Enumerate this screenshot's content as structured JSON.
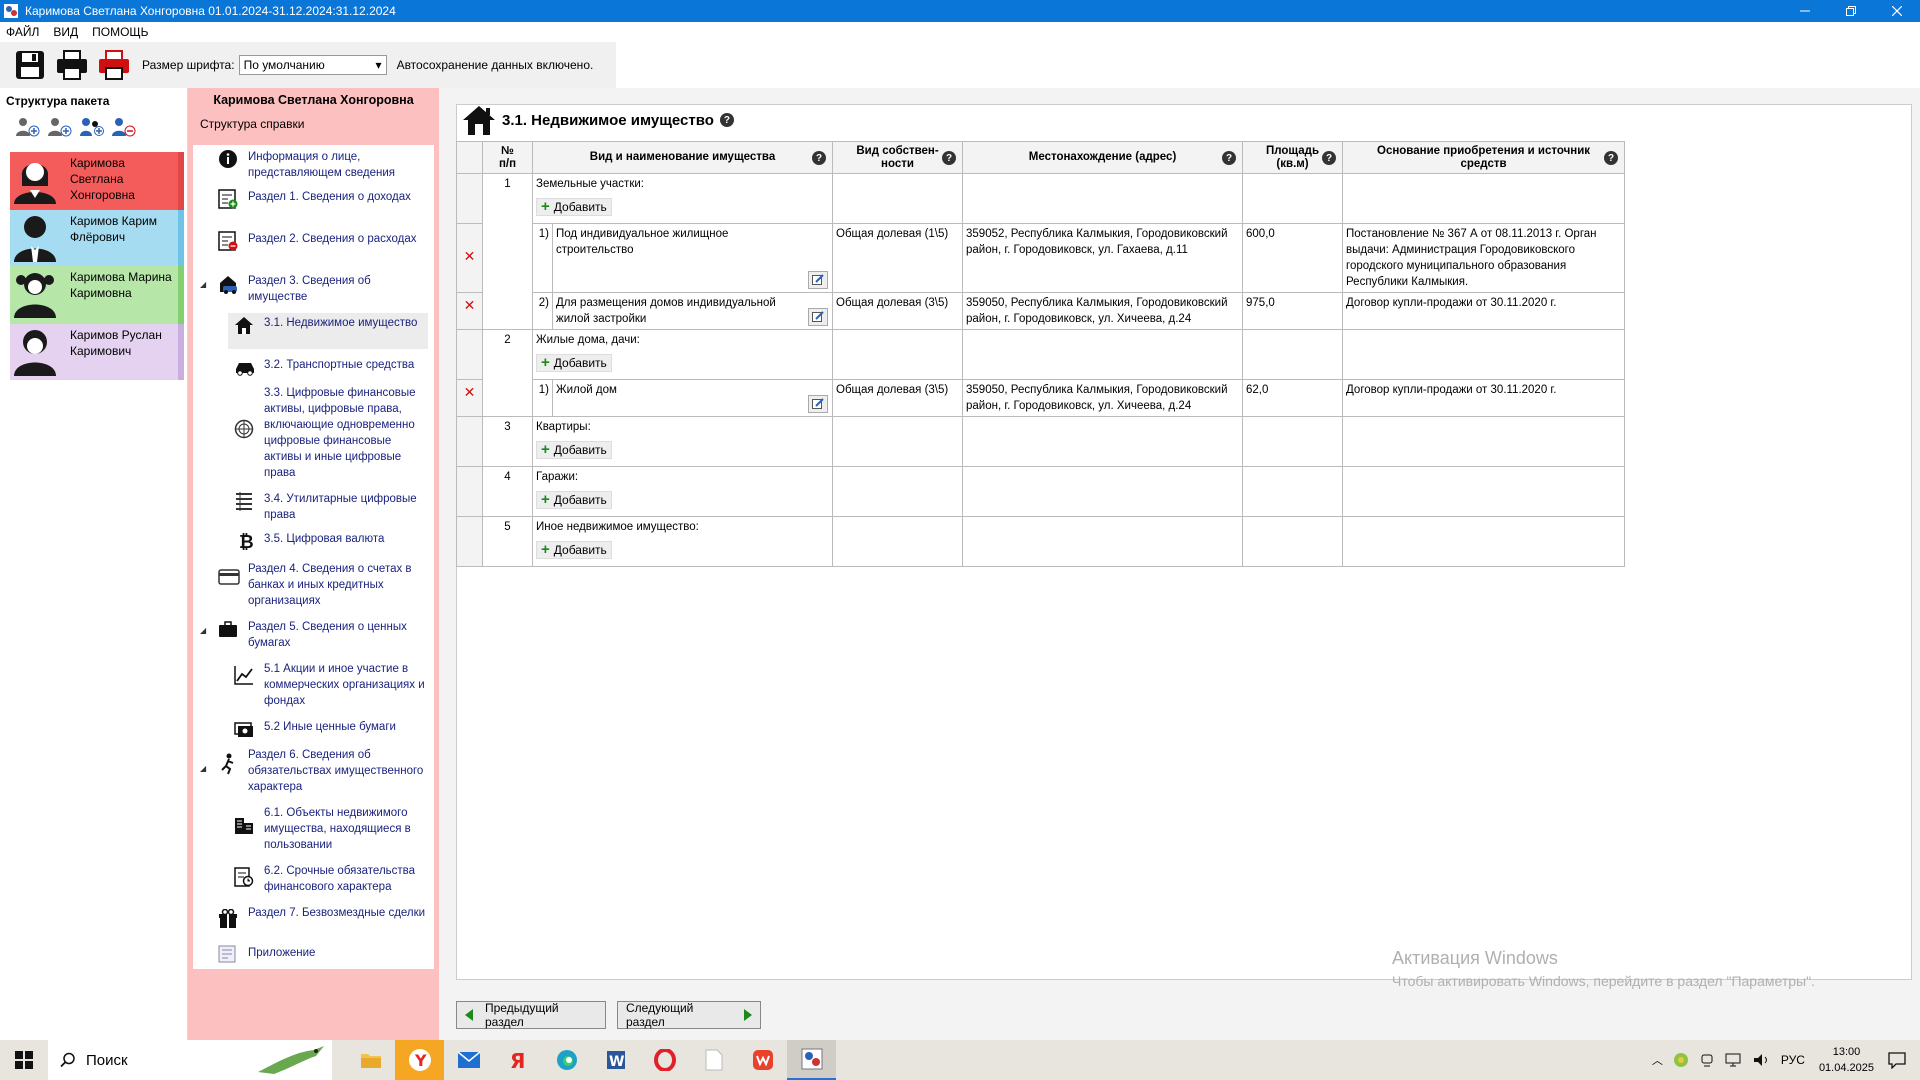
{
  "window": {
    "title": "Каримова Светлана Хонгоровна 01.01.2024-31.12.2024:31.12.2024"
  },
  "menu": [
    "ФАЙЛ",
    "ВИД",
    "ПОМОЩЬ"
  ],
  "toolbar": {
    "font_size_label": "Размер шрифта:",
    "font_size_value": "По умолчанию",
    "autosave": "Автосохранение данных включено."
  },
  "package": {
    "title": "Структура пакета",
    "persons": [
      {
        "name": "Каримова Светлана Хонгоровна",
        "color": "#f45b5b",
        "accent": "#e04848"
      },
      {
        "name": "Каримов Карим Флёрович",
        "color": "#a6dcf2",
        "accent": "#6ec4e6"
      },
      {
        "name": "Каримова Марина Каримовна",
        "color": "#b6e6a8",
        "accent": "#86cf70"
      },
      {
        "name": "Каримов Руслан Каримович",
        "color": "#e4d2f0",
        "accent": "#c9aee0"
      }
    ]
  },
  "structure": {
    "owner": "Каримова Светлана Хонгоровна",
    "subtitle": "Структура справки",
    "items": [
      "Информация о лице, представляющем сведения",
      "Раздел 1. Сведения о доходах",
      "Раздел 2. Сведения о расходах",
      "Раздел 3. Сведения об имуществе",
      "3.1. Недвижимое имущество",
      "3.2. Транспортные средства",
      "3.3. Цифровые финансовые активы, цифровые права, включающие одновременно цифровые финансовые активы и иные цифровые права",
      "3.4. Утилитарные цифровые права",
      "3.5. Цифровая валюта",
      "Раздел 4. Сведения о счетах в банках и иных кредитных организациях",
      "Раздел 5. Сведения о ценных бумагах",
      "5.1 Акции и иное участие в коммерческих организациях и фондах",
      "5.2 Иные ценные бумаги",
      "Раздел 6. Сведения об обязательствах имущественного характера",
      "6.1. Объекты недвижимого имущества, находящиеся в пользовании",
      "6.2. Срочные обязательства финансового характера",
      "Раздел 7. Безвозмездные сделки",
      "Приложение"
    ]
  },
  "section": {
    "title": "3.1. Недвижимое имущество"
  },
  "table": {
    "headers": [
      "№ п/п",
      "Вид и наименование имущества",
      "Вид собствен-ности",
      "Местонахождение (адрес)",
      "Площадь (кв.м)",
      "Основание приобретения и источник средств"
    ],
    "add_label": "Добавить",
    "groups": [
      {
        "num": "1",
        "name": "Земельные участки:"
      },
      {
        "num": "2",
        "name": "Жилые дома, дачи:"
      },
      {
        "num": "3",
        "name": "Квартиры:"
      },
      {
        "num": "4",
        "name": "Гаражи:"
      },
      {
        "num": "5",
        "name": "Иное недвижимое имущество:"
      }
    ],
    "rows": [
      {
        "idx": "1)",
        "name": "Под индивидуальное жилищное строительство",
        "ownership": "Общая долевая (1\\5)",
        "address": "359052, Республика Калмыкия, Городовиковский район, г. Городовиковск, ул. Гахаева, д.11",
        "area": "600,0",
        "basis": "Постановление № 367 А от 08.11.2013 г. Орган выдачи: Администрация Городовиковского городского муниципального образования Республики Калмыкия."
      },
      {
        "idx": "2)",
        "name": "Для размещения домов индивидуальной жилой застройки",
        "ownership": "Общая долевая (3\\5)",
        "address": "359050, Республика Калмыкия, Городовиковский район, г. Городовиковск, ул. Хичеева, д.24",
        "area": "975,0",
        "basis": "Договор купли-продажи от 30.11.2020 г."
      },
      {
        "idx": "1)",
        "name": "Жилой дом",
        "ownership": "Общая долевая (3\\5)",
        "address": "359050, Республика Калмыкия, Городовиковский район, г. Городовиковск, ул. Хичеева, д.24",
        "area": "62,0",
        "basis": "Договор купли-продажи от 30.11.2020 г."
      }
    ]
  },
  "nav": {
    "prev": "Предыдущий раздел",
    "next": "Следующий раздел"
  },
  "watermark": {
    "line1": "Активация Windows",
    "line2": "Чтобы активировать Windows, перейдите в раздел \"Параметры\"."
  },
  "taskbar": {
    "search": "Поиск",
    "lang": "РУС",
    "time": "13:00",
    "date": "01.04.2025"
  }
}
